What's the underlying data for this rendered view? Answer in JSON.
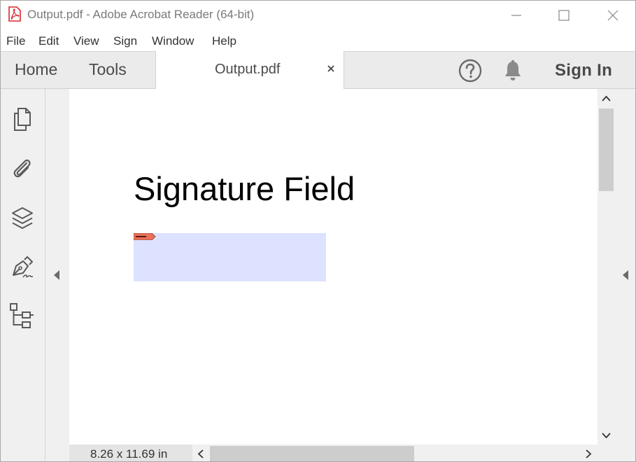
{
  "window": {
    "title": "Output.pdf - Adobe Acrobat Reader (64-bit)"
  },
  "menu": {
    "items": [
      "File",
      "Edit",
      "View",
      "Sign",
      "Window",
      "Help"
    ]
  },
  "tabs": {
    "home_label": "Home",
    "tools_label": "Tools",
    "document_tab_label": "Output.pdf",
    "sign_in_label": "Sign In"
  },
  "left_rail": {
    "icons": [
      "pages-icon",
      "attachment-icon",
      "layers-icon",
      "fill-sign-icon",
      "tags-icon"
    ]
  },
  "document": {
    "heading": "Signature Field",
    "signature_field_fill": "#dce2ff",
    "signature_flag_color": "#e8705a"
  },
  "status": {
    "page_size": "8.26 x 11.69 in"
  },
  "colors": {
    "acrobat_red": "#d7282f",
    "rail_bg": "#f0f0f0",
    "tabbar_bg": "#ebebeb"
  }
}
